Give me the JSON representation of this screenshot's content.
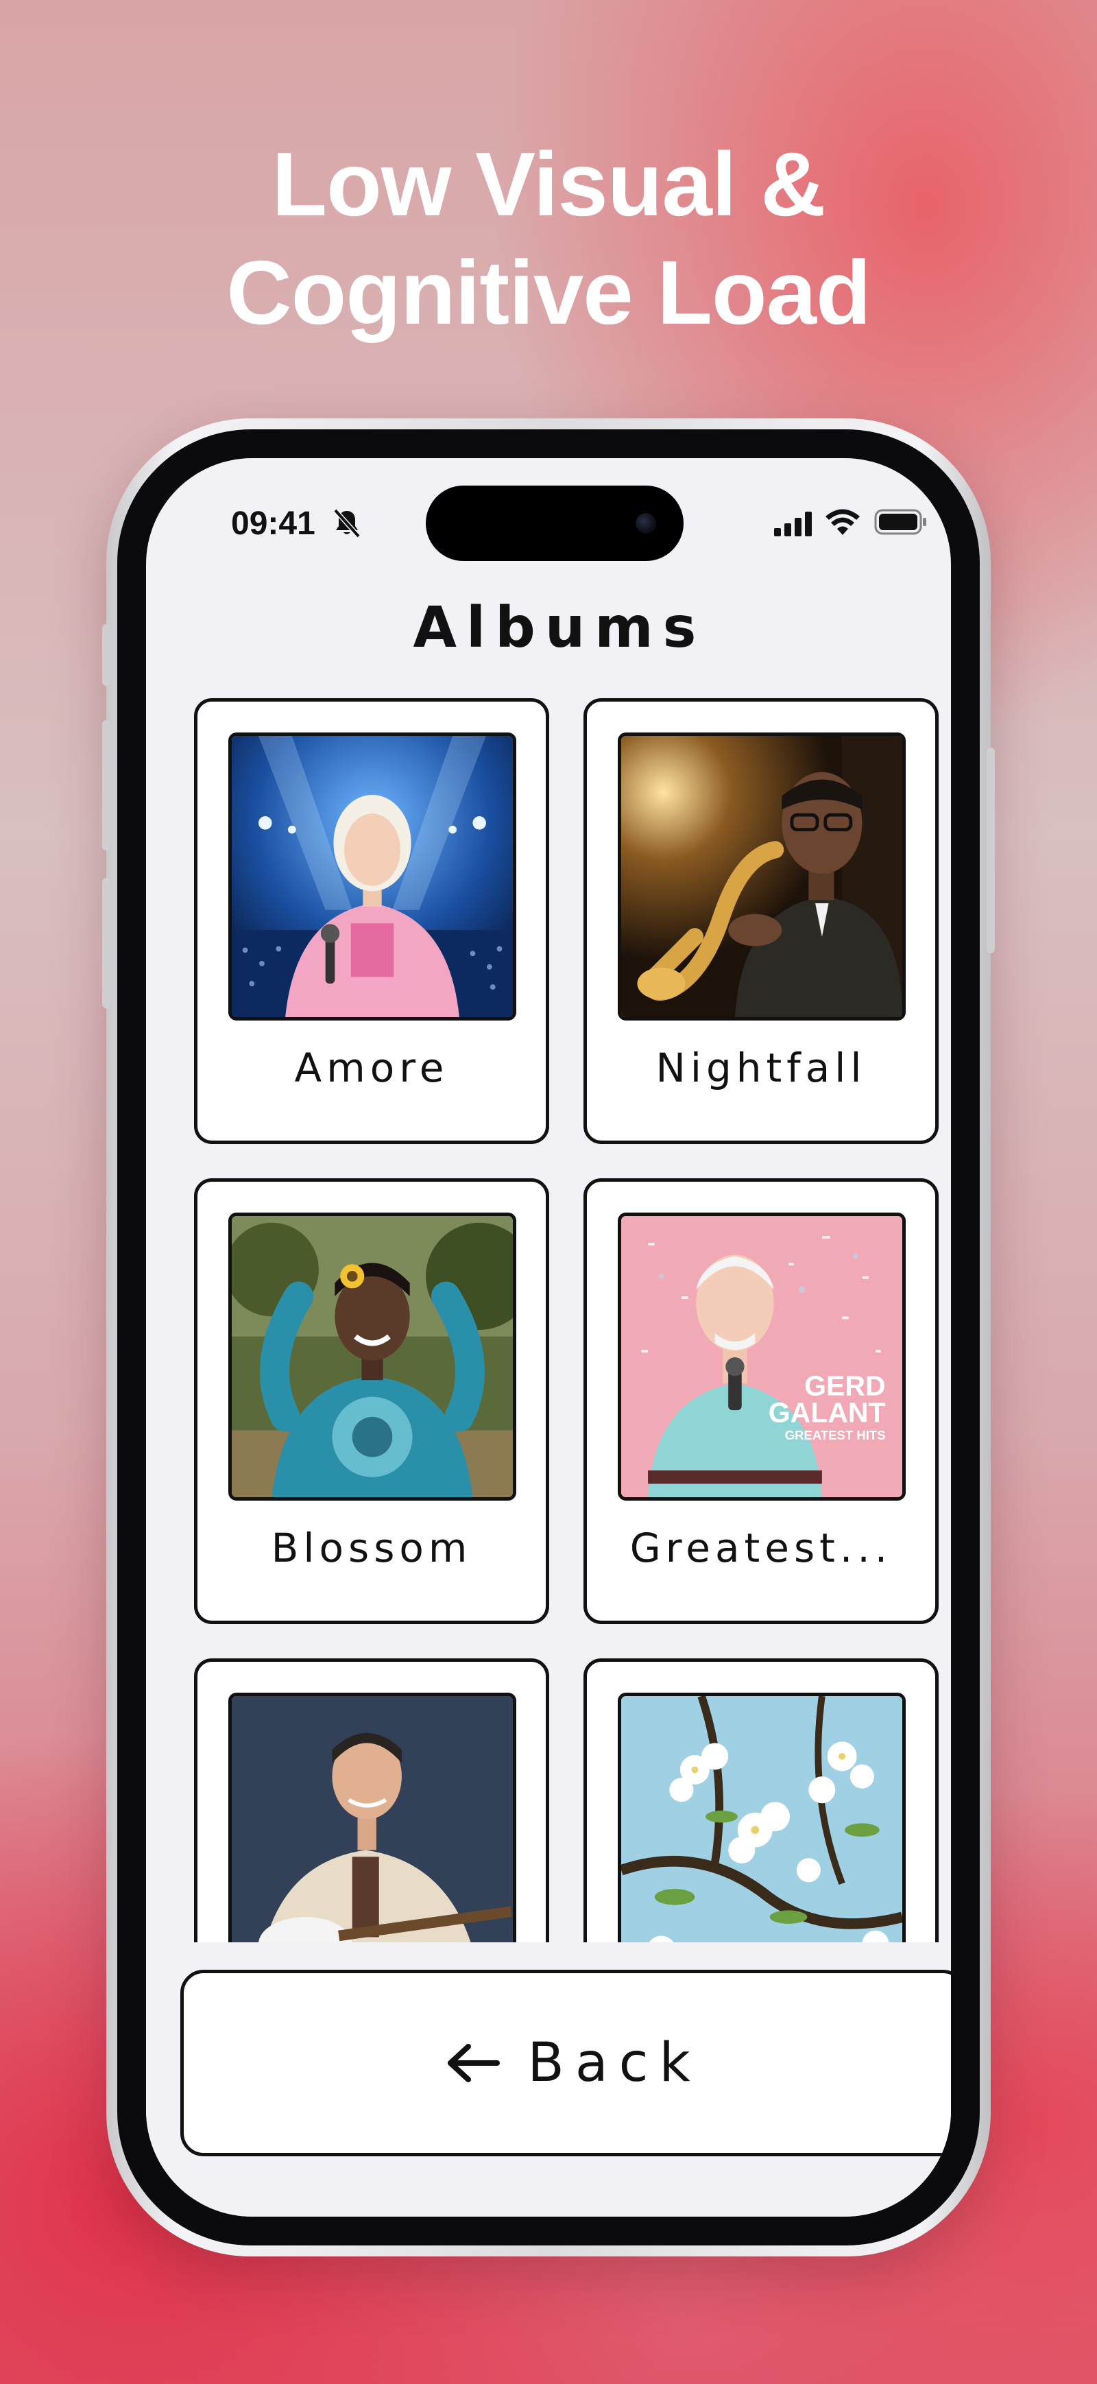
{
  "headline": {
    "line1": "Low Visual &",
    "line2": "Cognitive Load"
  },
  "status_bar": {
    "time": "09:41",
    "icons": [
      "bell-slash-icon",
      "cellular-signal-icon",
      "wifi-icon",
      "battery-icon"
    ]
  },
  "page": {
    "title": "Albums"
  },
  "albums": [
    {
      "title": "Amore",
      "art": "singer-with-microphone-on-stage"
    },
    {
      "title": "Nightfall",
      "art": "saxophone-player"
    },
    {
      "title": "Blossom",
      "art": "woman-in-tie-dye-sweater"
    },
    {
      "title": "Greatest...",
      "art": "older-singer-with-confetti",
      "art_text": [
        "GERD",
        "GALANT",
        "GREATEST HITS"
      ]
    },
    {
      "title": "",
      "art": "guitarist-in-beige-jacket"
    },
    {
      "title": "",
      "art": "white-blossoms"
    }
  ],
  "back_button": {
    "label": "Back",
    "icon": "arrow-left-icon"
  },
  "colors": {
    "screen_background": "#f1f1f6",
    "card_background": "#ffffff",
    "border": "#111111",
    "accent": "#e0324a"
  }
}
